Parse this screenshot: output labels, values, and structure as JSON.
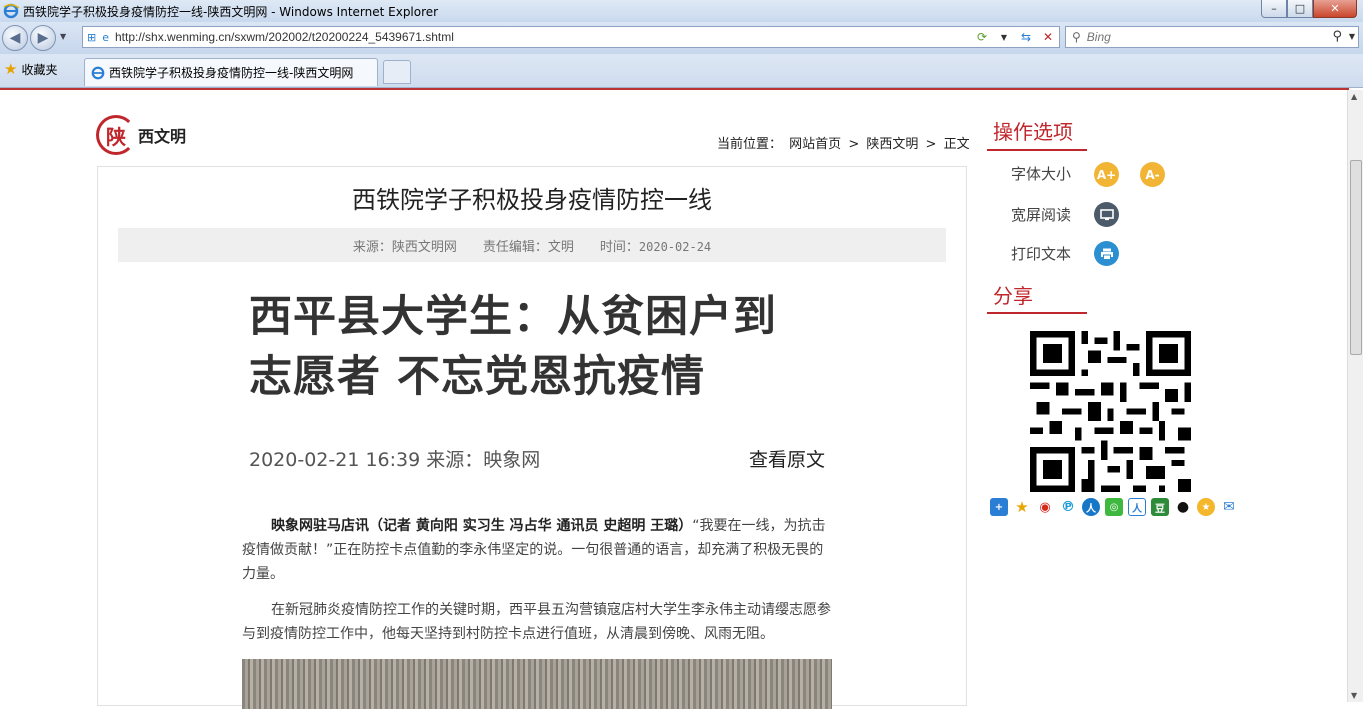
{
  "window": {
    "title": "西铁院学子积极投身疫情防控一线-陕西文明网 - Windows Internet Explorer",
    "minimize": "–",
    "maximize": "□",
    "close": "✕"
  },
  "toolbar": {
    "url": "http://shx.wenming.cn/sxwm/202002/t20200224_5439671.shtml",
    "search_placeholder": "Bing",
    "favorites_label": "收藏夹",
    "tab_title": "西铁院学子积极投身疫情防控一线-陕西文明网"
  },
  "site": {
    "logo_char": "陕",
    "logo_text": "西文明",
    "breadcrumb": {
      "prefix": "当前位置：",
      "home": "网站首页",
      "sep1": ">",
      "section": "陕西文明",
      "sep2": ">",
      "current": "正文"
    }
  },
  "article": {
    "title": "西铁院学子积极投身疫情防控一线",
    "meta": {
      "source": "来源：陕西文明网",
      "editor": "责任编辑：文明",
      "time_label": "时间：",
      "time_value": "2020-02-24"
    },
    "headline_line1": "西平县大学生：从贫困户到",
    "headline_line2": "志愿者 不忘党恩抗疫情",
    "subline": "2020-02-21 16:39  来源：映象网",
    "view_source": "查看原文",
    "para1_bold": "映象网驻马店讯（记者 黄向阳 实习生 冯占华 通讯员 史超明 王璐）",
    "para1_rest": "“我要在一线，为抗击疫情做贡献！”正在防控卡点值勤的李永伟坚定的说。一句很普通的语言，却充满了积极无畏的力量。",
    "para2": "在新冠肺炎疫情防控工作的关键时期，西平县五沟营镇寇店村大学生李永伟主动请缨志愿参与到疫情防控工作中，他每天坚持到村防控卡点进行值班，从清晨到傍晚、风雨无阻。"
  },
  "sidebar": {
    "options_title": "操作选项",
    "font_size_label": "字体大小",
    "font_increase": "A+",
    "font_decrease": "A-",
    "wide_read_label": "宽屏阅读",
    "print_label": "打印文本",
    "share_title": "分享",
    "share_icons": [
      "plus-share-icon",
      "favorite-star-icon",
      "weibo-icon",
      "pinterest-icon",
      "zhihu-icon",
      "wechat-icon",
      "renren-icon",
      "douban-icon",
      "qq-icon",
      "qzone-icon",
      "email-icon"
    ]
  },
  "colors": {
    "brand_red": "#c0272d",
    "accent_yellow": "#f2b435",
    "print_blue": "#2b8fd1"
  }
}
